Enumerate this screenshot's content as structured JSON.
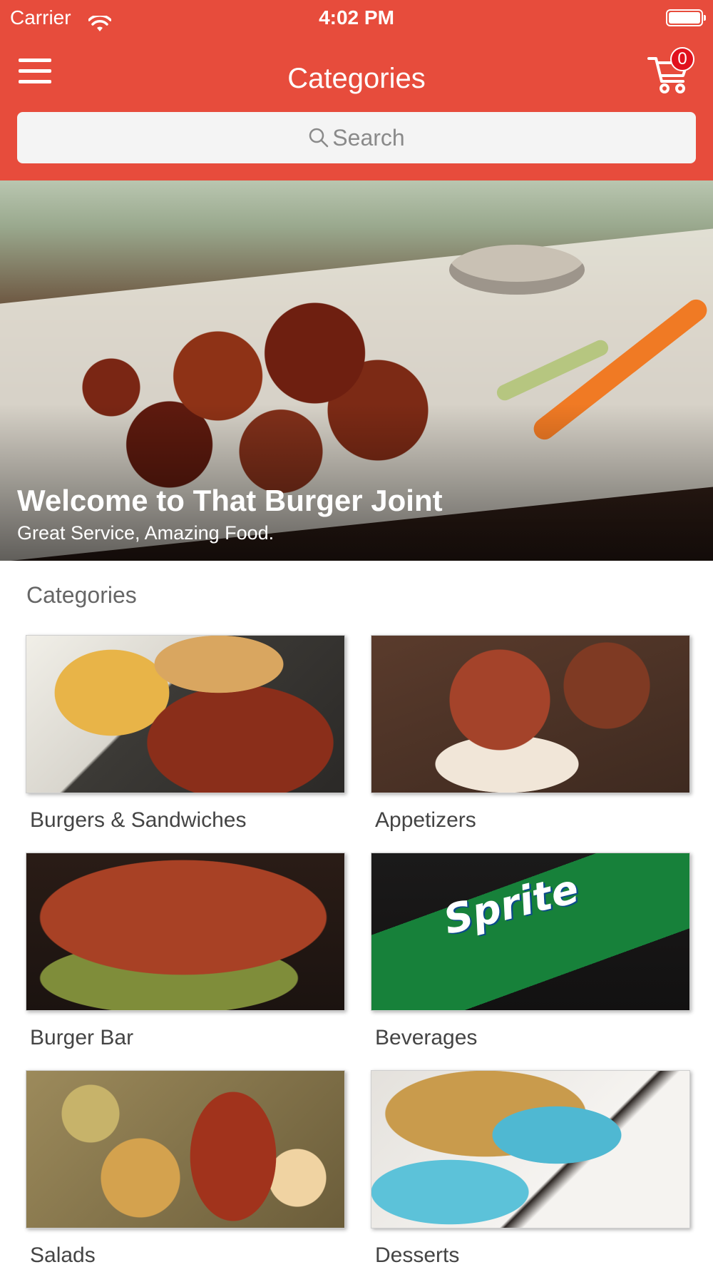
{
  "status_bar": {
    "carrier": "Carrier",
    "time": "4:02 PM"
  },
  "nav": {
    "title": "Categories",
    "cart_count": "0"
  },
  "search": {
    "placeholder": "Search"
  },
  "hero": {
    "title": "Welcome to That Burger Joint",
    "subtitle": "Great Service, Amazing Food."
  },
  "categories": {
    "heading": "Categories",
    "items": [
      {
        "label": "Burgers & Sandwiches"
      },
      {
        "label": "Appetizers"
      },
      {
        "label": "Burger Bar"
      },
      {
        "label": "Beverages",
        "image_text": "Sprite"
      },
      {
        "label": "Salads"
      },
      {
        "label": "Desserts"
      }
    ]
  },
  "colors": {
    "brand_red": "#e74c3c",
    "badge_red": "#e1121e",
    "search_bg": "#f4f4f4"
  },
  "icons": [
    "wifi-icon",
    "battery-icon",
    "hamburger-menu-icon",
    "cart-icon",
    "search-icon"
  ]
}
